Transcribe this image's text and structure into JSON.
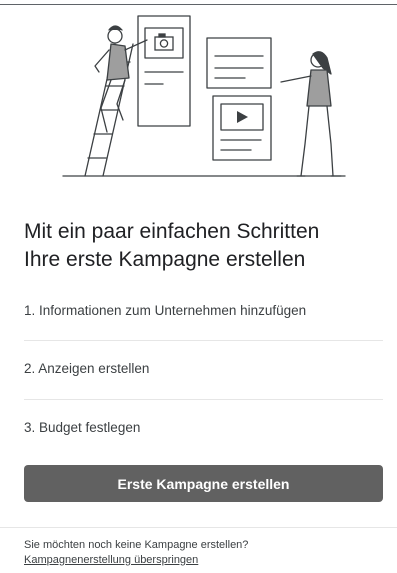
{
  "headline": {
    "line1": "Mit ein paar einfachen Schritten",
    "line2": "Ihre erste Kampagne erstellen"
  },
  "steps": [
    {
      "label": "1. Informationen zum Unternehmen hinzufügen"
    },
    {
      "label": "2. Anzeigen erstellen"
    },
    {
      "label": "3. Budget festlegen"
    }
  ],
  "cta": {
    "label": "Erste Kampagne erstellen"
  },
  "footer": {
    "question": "Sie möchten noch keine Kampagne erstellen?",
    "skip_link": "Kampagnenerstellung überspringen"
  },
  "illustration": {
    "icons": [
      "camera-icon",
      "play-icon"
    ]
  },
  "colors": {
    "button_bg": "#616161",
    "button_text": "#ffffff",
    "text": "#202124",
    "divider": "#e6e6e6"
  }
}
